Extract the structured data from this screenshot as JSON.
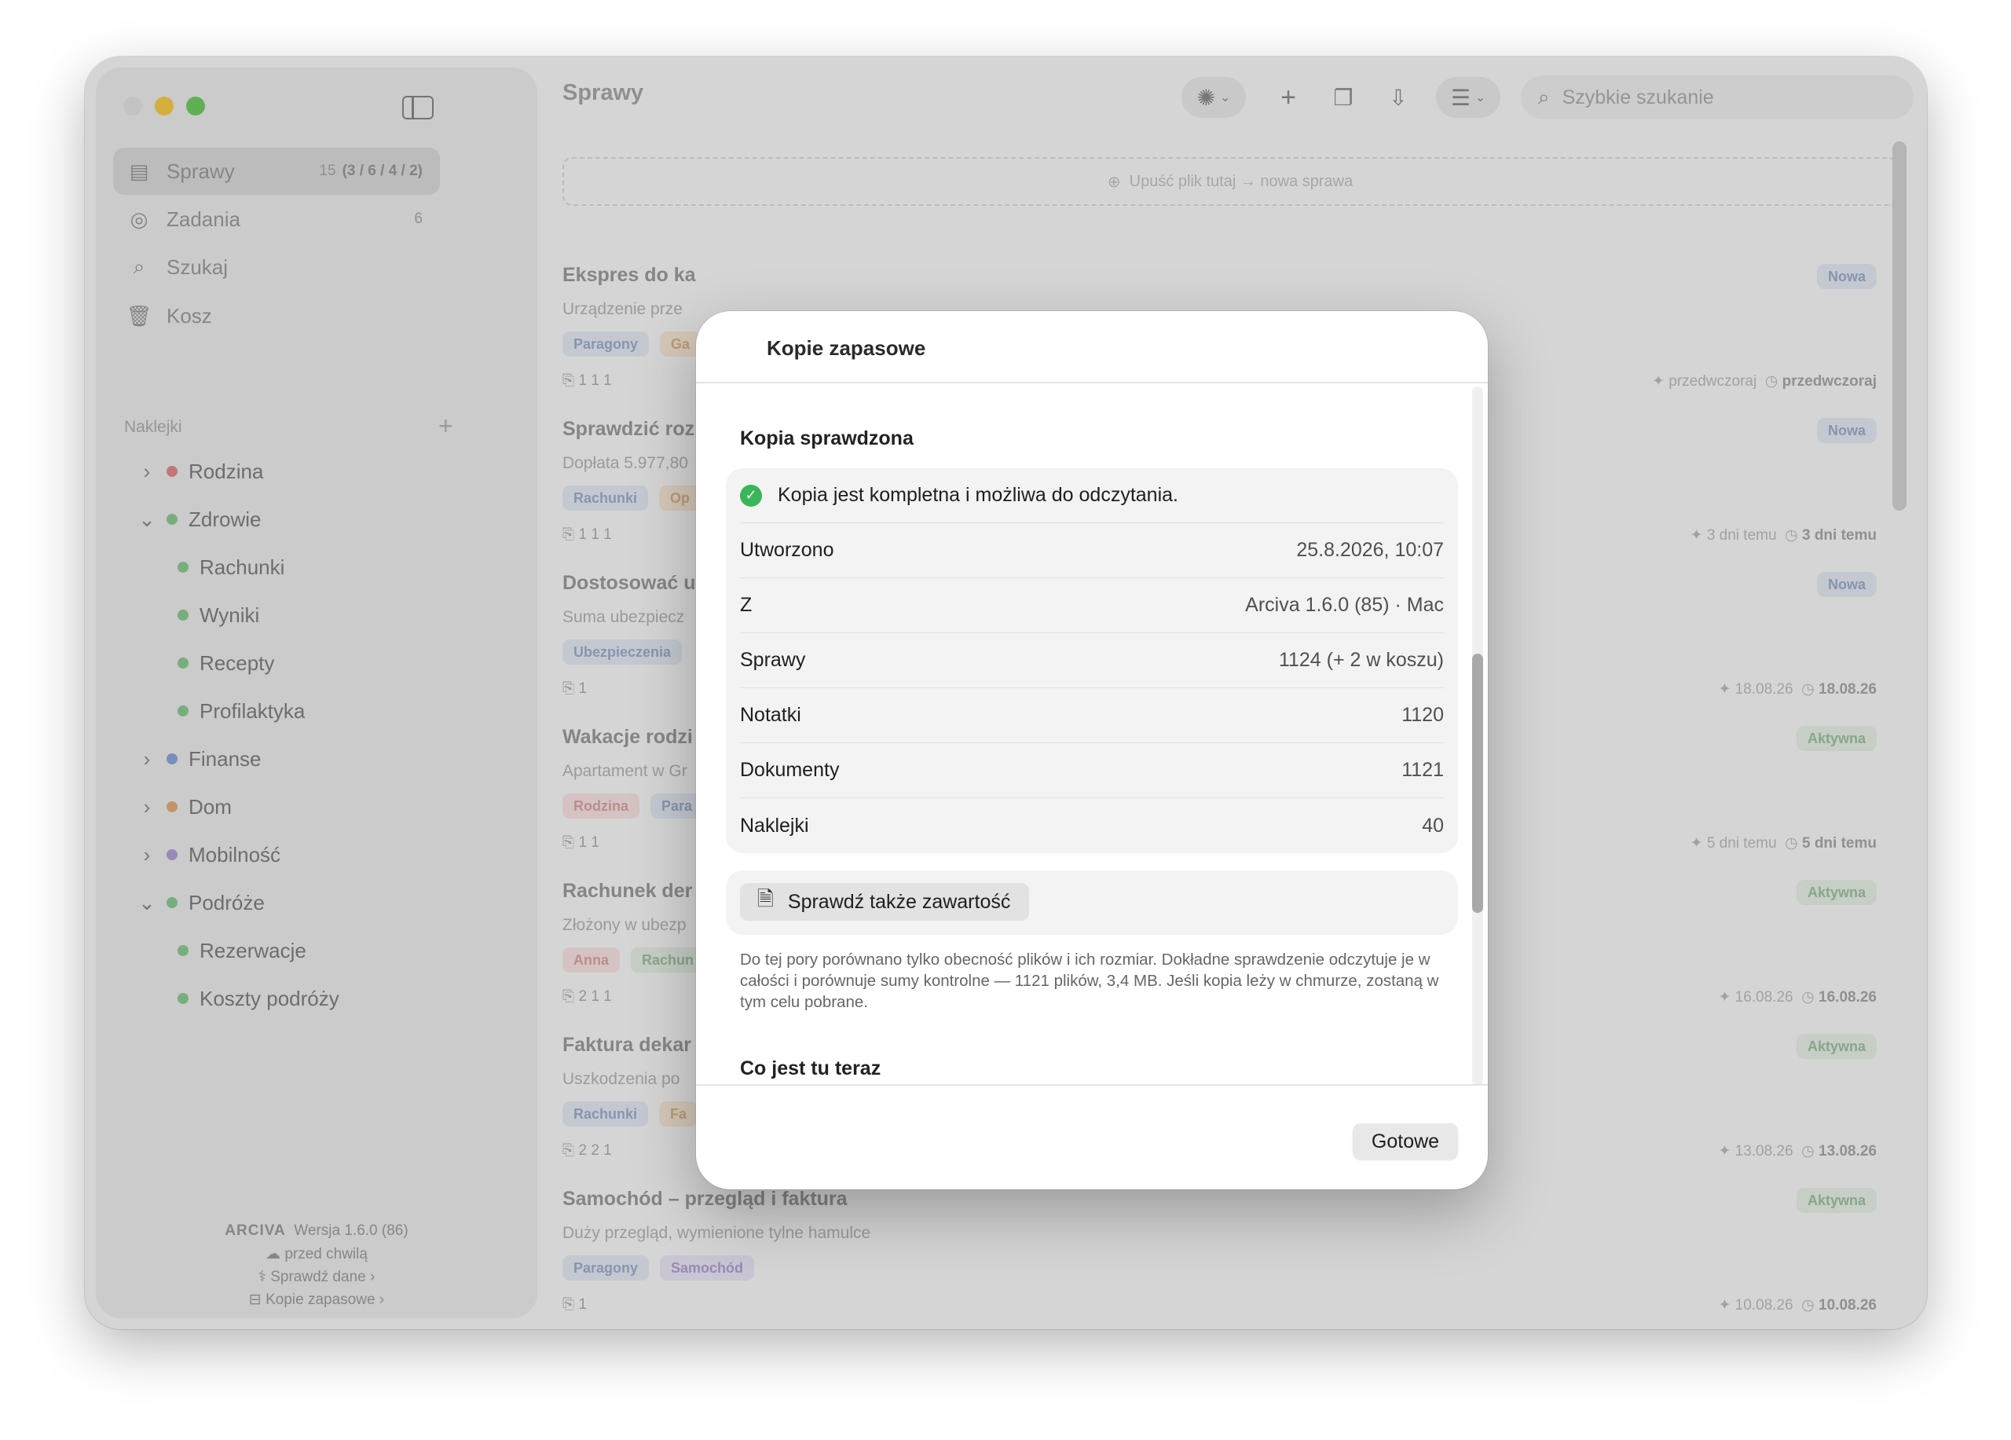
{
  "window": {
    "title": "Sprawy"
  },
  "sidebar": {
    "nav": [
      {
        "label": "Sprawy",
        "count": "15",
        "count_detail": "(3 / 6 / 4 / 2)",
        "icon": "tray-icon"
      },
      {
        "label": "Zadania",
        "count": "6",
        "icon": "checkmark-circle-icon"
      },
      {
        "label": "Szukaj",
        "icon": "search-icon"
      },
      {
        "label": "Kosz",
        "icon": "trash-icon"
      }
    ],
    "section_label": "Naklejki",
    "tags": [
      {
        "label": "Rodzina",
        "color": "#d87a7a"
      },
      {
        "label": "Zdrowie",
        "color": "#7cbf86"
      },
      {
        "label": "Rachunki",
        "color": "#7cbf86"
      },
      {
        "label": "Wyniki",
        "color": "#7cbf86"
      },
      {
        "label": "Recepty",
        "color": "#7cbf86"
      },
      {
        "label": "Profilaktyka",
        "color": "#7cbf86"
      },
      {
        "label": "Finanse",
        "color": "#7d98cf"
      },
      {
        "label": "Dom",
        "color": "#d9a06c"
      },
      {
        "label": "Mobilność",
        "color": "#a592c9"
      },
      {
        "label": "Podróże",
        "color": "#7cbf86"
      },
      {
        "label": "Rezerwacje",
        "color": "#7cbf86"
      },
      {
        "label": "Koszty podróży",
        "color": "#7cbf86"
      }
    ],
    "footer": {
      "brand": "ARCIVA",
      "version": "Wersja 1.6.0 (86)",
      "sync": "przed chwilą",
      "check_data": "Sprawdź dane",
      "backups": "Kopie zapasowe"
    }
  },
  "toolbar": {
    "search_placeholder": "Szybkie szukanie",
    "dropzone": "Upuść plik tutaj → nowa sprawa"
  },
  "cases": [
    {
      "title": "Ekspres do ka",
      "desc": "Urządzenie prze",
      "chips": [
        "Paragony",
        "Ga"
      ],
      "meta": "1   1   1",
      "status": "Nowa",
      "date1": "przedwczoraj",
      "date2": "przedwczoraj"
    },
    {
      "title": "Sprawdzić roz",
      "desc": "Dopłata 5.977,80",
      "chips": [
        "Rachunki",
        "Op"
      ],
      "meta": "1   1   1",
      "status": "Nowa",
      "date1": "3 dni temu",
      "date2": "3 dni temu"
    },
    {
      "title": "Dostosować u",
      "desc": "Suma ubezpiecz",
      "chips": [
        "Ubezpieczenia"
      ],
      "meta": "1",
      "status": "Nowa",
      "date1": "18.08.26",
      "date2": "18.08.26"
    },
    {
      "title": "Wakacje rodzi",
      "desc": "Apartament w Gr",
      "chips": [
        "Rodzina",
        "Para"
      ],
      "meta": "1   1",
      "status": "Aktywna",
      "date1": "5 dni temu",
      "date2": "5 dni temu"
    },
    {
      "title": "Rachunek der",
      "desc": "Złożony w ubezp",
      "chips": [
        "Anna",
        "Rachun"
      ],
      "meta": "2   1   1",
      "status": "Aktywna",
      "date1": "16.08.26",
      "date2": "16.08.26"
    },
    {
      "title": "Faktura dekar",
      "desc": "Uszkodzenia po",
      "chips": [
        "Rachunki",
        "Fa"
      ],
      "meta": "2   2   1",
      "status": "Aktywna",
      "date1": "13.08.26",
      "date2": "13.08.26"
    },
    {
      "title": "Samochód – przegląd i faktura",
      "desc": "Duży przegląd, wymienione tylne hamulce",
      "chips": [
        "Paragony",
        "Samochód"
      ],
      "meta": "1",
      "status": "Aktywna",
      "date1": "10.08.26",
      "date2": "10.08.26"
    }
  ],
  "chip_colors": {
    "Paragony": [
      "#dde3ee",
      "#8fa1c2"
    ],
    "Ga": [
      "#f2e2cf",
      "#d3a877"
    ],
    "Rachunki": [
      "#dde3ee",
      "#8fa1c2"
    ],
    "Op": [
      "#f2e2cf",
      "#d3a877"
    ],
    "Ubezpieczenia": [
      "#dde3ee",
      "#8fa1c2"
    ],
    "Rodzina": [
      "#f3dcdc",
      "#d49595"
    ],
    "Para": [
      "#dde3ee",
      "#8fa1c2"
    ],
    "Anna": [
      "#f3dcdc",
      "#d49595"
    ],
    "Rachun": [
      "#dfe9df",
      "#8fb793"
    ],
    "Fa": [
      "#f2e2cf",
      "#d3a877"
    ],
    "Samochód": [
      "#e5def0",
      "#a592c9"
    ]
  },
  "modal": {
    "title": "Kopie zapasowe",
    "section1": "Kopia sprawdzona",
    "ok_message": "Kopia jest kompletna i możliwa do odczytania.",
    "rows": [
      {
        "k": "Utworzono",
        "v": "25.8.2026, 10:07"
      },
      {
        "k": "Z",
        "v": "Arciva 1.6.0 (85) · Mac"
      },
      {
        "k": "Sprawy",
        "v": "1124 (+ 2 w koszu)"
      },
      {
        "k": "Notatki",
        "v": "1120"
      },
      {
        "k": "Dokumenty",
        "v": "1121"
      },
      {
        "k": "Naklejki",
        "v": "40"
      }
    ],
    "check_button": "Sprawdź także zawartość",
    "explain": "Do tej pory porównano tylko obecność plików i ich rozmiar. Dokładne sprawdzenie odczytuje je w całości i porównuje sumy kontrolne — 1121 plików, 3,4 MB. Jeśli kopia leży w chmurze, zostaną w tym celu pobrane.",
    "section2": "Co jest tu teraz",
    "done": "Gotowe"
  }
}
